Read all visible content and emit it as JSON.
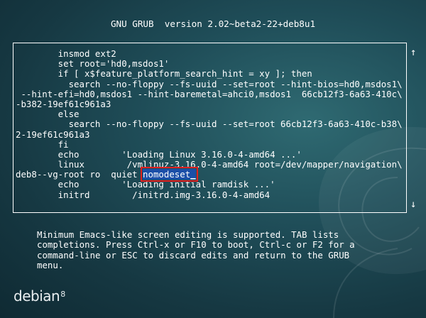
{
  "header": {
    "title": "GNU GRUB  version 2.02~beta2-22+deb8u1"
  },
  "editor": {
    "lines": [
      "        insmod ext2",
      "        set root='hd0,msdos1'",
      "        if [ x$feature_platform_search_hint = xy ]; then",
      "          search --no-floppy --fs-uuid --set=root --hint-bios=hd0,msdos1\\",
      " --hint-efi=hd0,msdos1 --hint-baremetal=ahci0,msdos1  66cb12f3-6a63-410c\\",
      "-b382-19ef61c961a3",
      "        else",
      "          search --no-floppy --fs-uuid --set=root 66cb12f3-6a63-410c-b38\\",
      "2-19ef61c961a3",
      "        fi",
      "        echo        'Loading Linux 3.16.0-4-amd64 ...'",
      "        linux        /vmlinuz-3.16.0-4-amd64 root=/dev/mapper/navigation\\"
    ],
    "edited_line_prefix": "deb8--vg-root ro  quiet ",
    "edited_value": "nomodeset",
    "cursor": "_",
    "lines_after": [
      "        echo        'Loading initial ramdisk ...'",
      "        initrd        /initrd.img-3.16.0-4-amd64"
    ],
    "scroll_up_glyph": "↑",
    "scroll_down_glyph": "↓"
  },
  "help": {
    "lines": [
      "Minimum Emacs-like screen editing is supported. TAB lists",
      "completions. Press Ctrl-x or F10 to boot, Ctrl-c or F2 for a",
      "command-line or ESC to discard edits and return to the GRUB",
      "menu."
    ]
  },
  "branding": {
    "logo_text": "debian",
    "logo_version": "8"
  },
  "colors": {
    "text": "#ffffff",
    "highlight_bg": "#1a4fa8",
    "highlight_outline": "#e02020"
  }
}
